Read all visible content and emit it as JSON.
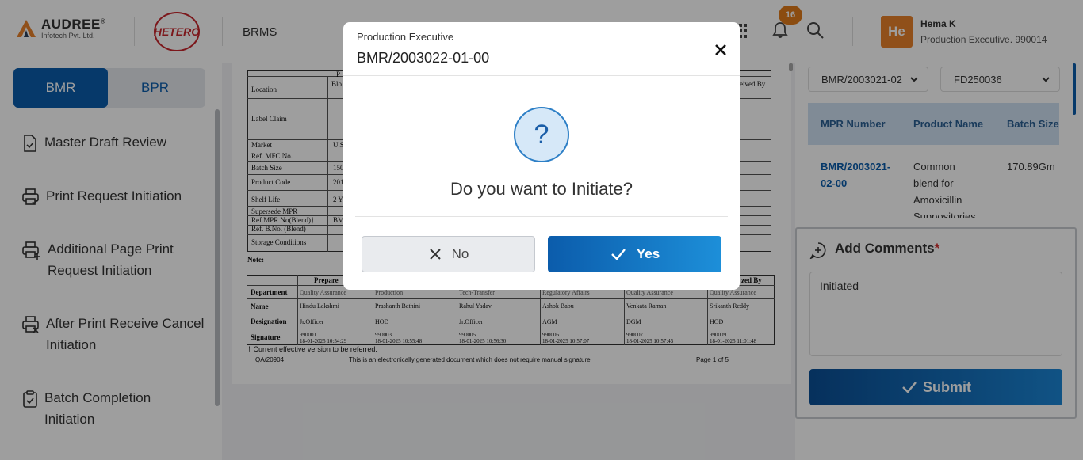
{
  "header": {
    "company_name": "AUDREE",
    "company_reg": "®",
    "company_sub": "Infotech Pvt. Ltd.",
    "partner_logo": "HETERO",
    "app_name": "BRMS",
    "notification_count": "16",
    "user_initials": "He",
    "user_name": "Hema K",
    "user_role": "Production Executive. 990014"
  },
  "sidebar": {
    "toggle": {
      "active": "BMR",
      "inactive": "BPR"
    },
    "items": [
      {
        "label": "Master Draft Review",
        "icon": "document-check-icon"
      },
      {
        "label": "Print Request Initiation",
        "icon": "printer-check-icon"
      },
      {
        "label": "Additional Page Print Request Initiation",
        "icon": "printer-add-icon"
      },
      {
        "label": "After Print Receive Cancel Initiation",
        "icon": "printer-cancel-icon"
      },
      {
        "label": "Batch Completion Initiation",
        "icon": "clipboard-check-icon"
      }
    ]
  },
  "document": {
    "col_header_p": "P",
    "col_header_received": "eived By",
    "rows": [
      "Location",
      "Label Claim",
      "Market",
      "Ref. MFC No.",
      "Batch Size",
      "Product Code",
      "Shelf Life",
      "Supersede MPR",
      "Ref.MPR No(Blend)†",
      "Ref. B.No. (Blend)",
      "Storage Conditions"
    ],
    "row_values": [
      "Blo",
      "",
      "U.S",
      "",
      "150",
      "201",
      "2 Y",
      "",
      "BM",
      "",
      ""
    ],
    "note": "Note:",
    "sig_header_prepared": "Prepare",
    "sig_header_authorized": "zed By",
    "sig_row_labels": [
      "Department",
      "Name",
      "Designation",
      "Signature"
    ],
    "sig_columns": [
      {
        "dept": "Quality Assurance",
        "name": "Hindu  Lakshmi",
        "desig": "Jr.Officer",
        "sig": "990001",
        "date": "18-01-2025 10:54:29"
      },
      {
        "dept": "Production",
        "name": "Prashanth  Bathini",
        "desig": "HOD",
        "sig": "990003",
        "date": "18-01-2025 10:55:48"
      },
      {
        "dept": "Tech-Transfer",
        "name": "Rahul  Yadav",
        "desig": "Jr.Officer",
        "sig": "990005",
        "date": "18-01-2025 10:56:30"
      },
      {
        "dept": "Regulatory Affairs",
        "name": "Ashok  Babu",
        "desig": "AGM",
        "sig": "990006",
        "date": "18-01-2025 10:57:07"
      },
      {
        "dept": "Quality Assurance",
        "name": "Venkata  Raman",
        "desig": "DGM",
        "sig": "990007",
        "date": "18-01-2025 10:57:45"
      },
      {
        "dept": "Quality Assurance",
        "name": "Srikanth  Reddy",
        "desig": "HOD",
        "sig": "990009",
        "date": "18-01-2025 11:01:48"
      }
    ],
    "footnote": "† Current effective version to be referred.",
    "footer_left": "QA/20904",
    "footer_center": "This is an electronically generated document which does not require manual signature",
    "footer_right": "Page 1 of 5"
  },
  "right_panel": {
    "select_bmr": "BMR/2003021-02",
    "select_batch": "FD250036",
    "table_headers": [
      "MPR Number",
      "Product Name",
      "Batch Size"
    ],
    "row": {
      "mpr_line1": "BMR/2003021-",
      "mpr_line2": "02-00",
      "product_lines": [
        "Common",
        "blend for",
        "Amoxicillin",
        "Suppositories"
      ],
      "batch_size": "170.89Gm"
    },
    "comments_title": "Add Comments",
    "required_mark": "*",
    "comment_value": "Initiated",
    "submit_label": "Submit"
  },
  "modal": {
    "subtitle": "Production Executive",
    "title": "BMR/2003022-01-00",
    "question_mark": "?",
    "question": "Do you want to Initiate?",
    "no_label": "No",
    "yes_label": "Yes"
  },
  "colors": {
    "primary": "#0b5cab",
    "accent_orange": "#e07b1a",
    "hetero_red": "#c8262c"
  }
}
